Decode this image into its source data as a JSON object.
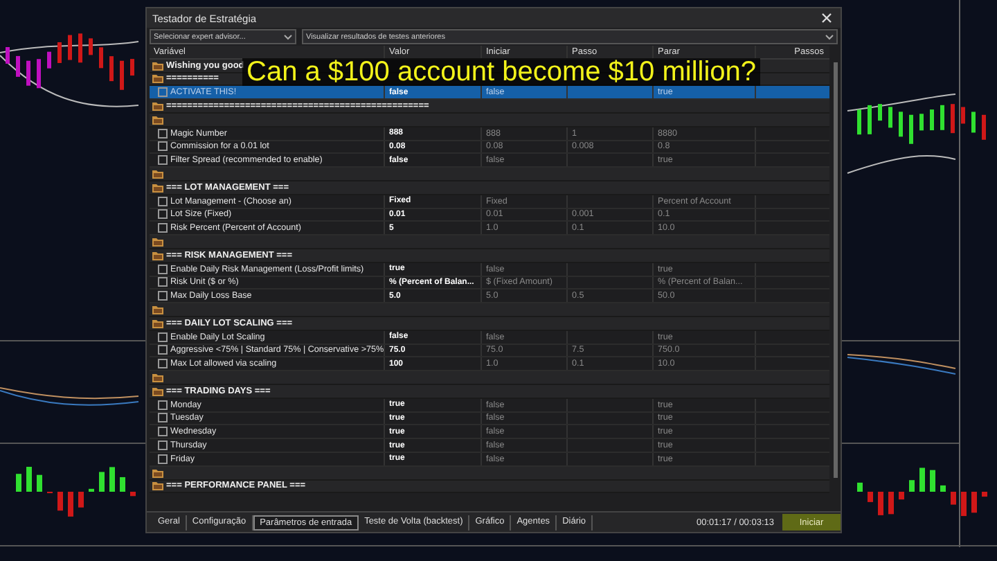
{
  "caption": "Can a $100 account become $10 million?",
  "window": {
    "title": "Testador de Estratégia"
  },
  "selectors": [
    {
      "label": "Selecionar expert advisor..."
    },
    {
      "label": "Visualizar resultados de testes anteriores"
    }
  ],
  "columns": [
    "Variável",
    "Valor",
    "Iniciar",
    "Passo",
    "Parar",
    "Passos"
  ],
  "rows": [
    {
      "kind": "group",
      "label": "Wishing you good"
    },
    {
      "kind": "group",
      "label": "=========="
    },
    {
      "kind": "param",
      "label": "ACTIVATE THIS!",
      "checked": false,
      "selected": true,
      "value": "false",
      "start": "false",
      "stop": "true"
    },
    {
      "kind": "group",
      "label": "=================================================="
    },
    {
      "kind": "group"
    },
    {
      "kind": "param",
      "label": "Magic Number",
      "checked": false,
      "selected": false,
      "value": "888",
      "start": "888",
      "step": "1",
      "stop": "8880"
    },
    {
      "kind": "param",
      "label": "Commission for a 0.01 lot",
      "checked": false,
      "selected": false,
      "value": "0.08",
      "start": "0.08",
      "step": "0.008",
      "stop": "0.8"
    },
    {
      "kind": "param",
      "label": "Filter Spread (recommended to enable)",
      "checked": false,
      "selected": false,
      "value": "false",
      "start": "false",
      "stop": "true"
    },
    {
      "kind": "group"
    },
    {
      "kind": "group",
      "label": "=== LOT MANAGEMENT ==="
    },
    {
      "kind": "param",
      "label": "Lot Management - (Choose an)",
      "checked": false,
      "selected": false,
      "value": "Fixed",
      "start": "Fixed",
      "stop": "Percent of Account"
    },
    {
      "kind": "param",
      "label": "Lot Size (Fixed)",
      "checked": false,
      "selected": false,
      "value": "0.01",
      "start": "0.01",
      "step": "0.001",
      "stop": "0.1"
    },
    {
      "kind": "param",
      "label": "Risk Percent (Percent of Account)",
      "checked": false,
      "selected": false,
      "value": "5",
      "start": "1.0",
      "step": "0.1",
      "stop": "10.0"
    },
    {
      "kind": "group"
    },
    {
      "kind": "group",
      "label": "=== RISK MANAGEMENT ==="
    },
    {
      "kind": "param",
      "label": "Enable Daily Risk Management (Loss/Profit limits)",
      "checked": false,
      "selected": false,
      "value": "true",
      "start": "false",
      "stop": "true"
    },
    {
      "kind": "param",
      "label": "Risk Unit ($ or %)",
      "checked": false,
      "selected": false,
      "value": "% (Percent of Balan...",
      "start": "$ (Fixed Amount)",
      "stop": "% (Percent of Balan..."
    },
    {
      "kind": "param",
      "label": "Max Daily Loss Base",
      "checked": false,
      "selected": false,
      "value": "5.0",
      "start": "5.0",
      "step": "0.5",
      "stop": "50.0"
    },
    {
      "kind": "group"
    },
    {
      "kind": "group",
      "label": "=== DAILY LOT SCALING ==="
    },
    {
      "kind": "param",
      "label": "Enable Daily Lot Scaling",
      "checked": false,
      "selected": false,
      "value": "false",
      "start": "false",
      "stop": "true"
    },
    {
      "kind": "param",
      "label": "Aggressive <75% | Standard 75% | Conservative >75%",
      "checked": false,
      "selected": false,
      "value": "75.0",
      "start": "75.0",
      "step": "7.5",
      "stop": "750.0"
    },
    {
      "kind": "param",
      "label": "Max Lot allowed via scaling",
      "checked": false,
      "selected": false,
      "value": "100",
      "start": "1.0",
      "step": "0.1",
      "stop": "10.0"
    },
    {
      "kind": "group"
    },
    {
      "kind": "group",
      "label": "=== TRADING DAYS ==="
    },
    {
      "kind": "param",
      "label": "Monday",
      "checked": false,
      "selected": false,
      "value": "true",
      "start": "false",
      "stop": "true"
    },
    {
      "kind": "param",
      "label": "Tuesday",
      "checked": false,
      "selected": false,
      "value": "true",
      "start": "false",
      "stop": "true"
    },
    {
      "kind": "param",
      "label": "Wednesday",
      "checked": false,
      "selected": false,
      "value": "true",
      "start": "false",
      "stop": "true"
    },
    {
      "kind": "param",
      "label": "Thursday",
      "checked": false,
      "selected": false,
      "value": "true",
      "start": "false",
      "stop": "true"
    },
    {
      "kind": "param",
      "label": "Friday",
      "checked": false,
      "selected": false,
      "value": "true",
      "start": "false",
      "stop": "true"
    },
    {
      "kind": "group"
    },
    {
      "kind": "group",
      "label": "=== PERFORMANCE PANEL ==="
    }
  ],
  "tabs": [
    {
      "label": "Geral",
      "selected": false
    },
    {
      "label": "Configuração",
      "selected": false
    },
    {
      "label": "Parâmetros de entrada",
      "selected": true
    },
    {
      "label": "Teste de Volta (backtest)",
      "selected": false
    },
    {
      "label": "Gráfico",
      "selected": false
    },
    {
      "label": "Agentes",
      "selected": false
    },
    {
      "label": "Diário",
      "selected": false
    }
  ],
  "timer": "00:01:17 / 00:03:13",
  "start_button": "Iniciar"
}
